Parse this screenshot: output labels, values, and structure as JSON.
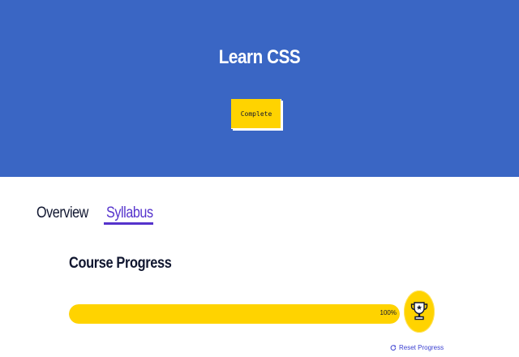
{
  "hero": {
    "title": "Learn CSS",
    "button_label": "Complete",
    "bg_color": "#3a66c4",
    "accent_color": "#ffd300"
  },
  "tabs": [
    {
      "label": "Overview",
      "active": false
    },
    {
      "label": "Syllabus",
      "active": true
    }
  ],
  "progress": {
    "title": "Course Progress",
    "percent": 1.0,
    "percent_label": "100%",
    "badge_icon": "trophy-icon",
    "reset_label": "Reset Progress",
    "reset_icon": "refresh-icon"
  }
}
